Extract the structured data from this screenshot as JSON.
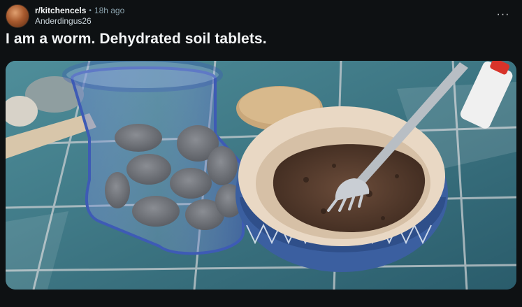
{
  "post": {
    "subreddit": "r/kitchencels",
    "separator": "•",
    "age": "18h ago",
    "username": "Anderdingus26",
    "title": "I am a worm. Dehydrated soil tablets.",
    "more_label": "···"
  },
  "icons": {
    "avatar": "avatar-image",
    "more": "more-options-icon"
  },
  "colors": {
    "background": "#0e1113",
    "text": "#f2f4f5",
    "muted": "#8ba2ad"
  }
}
